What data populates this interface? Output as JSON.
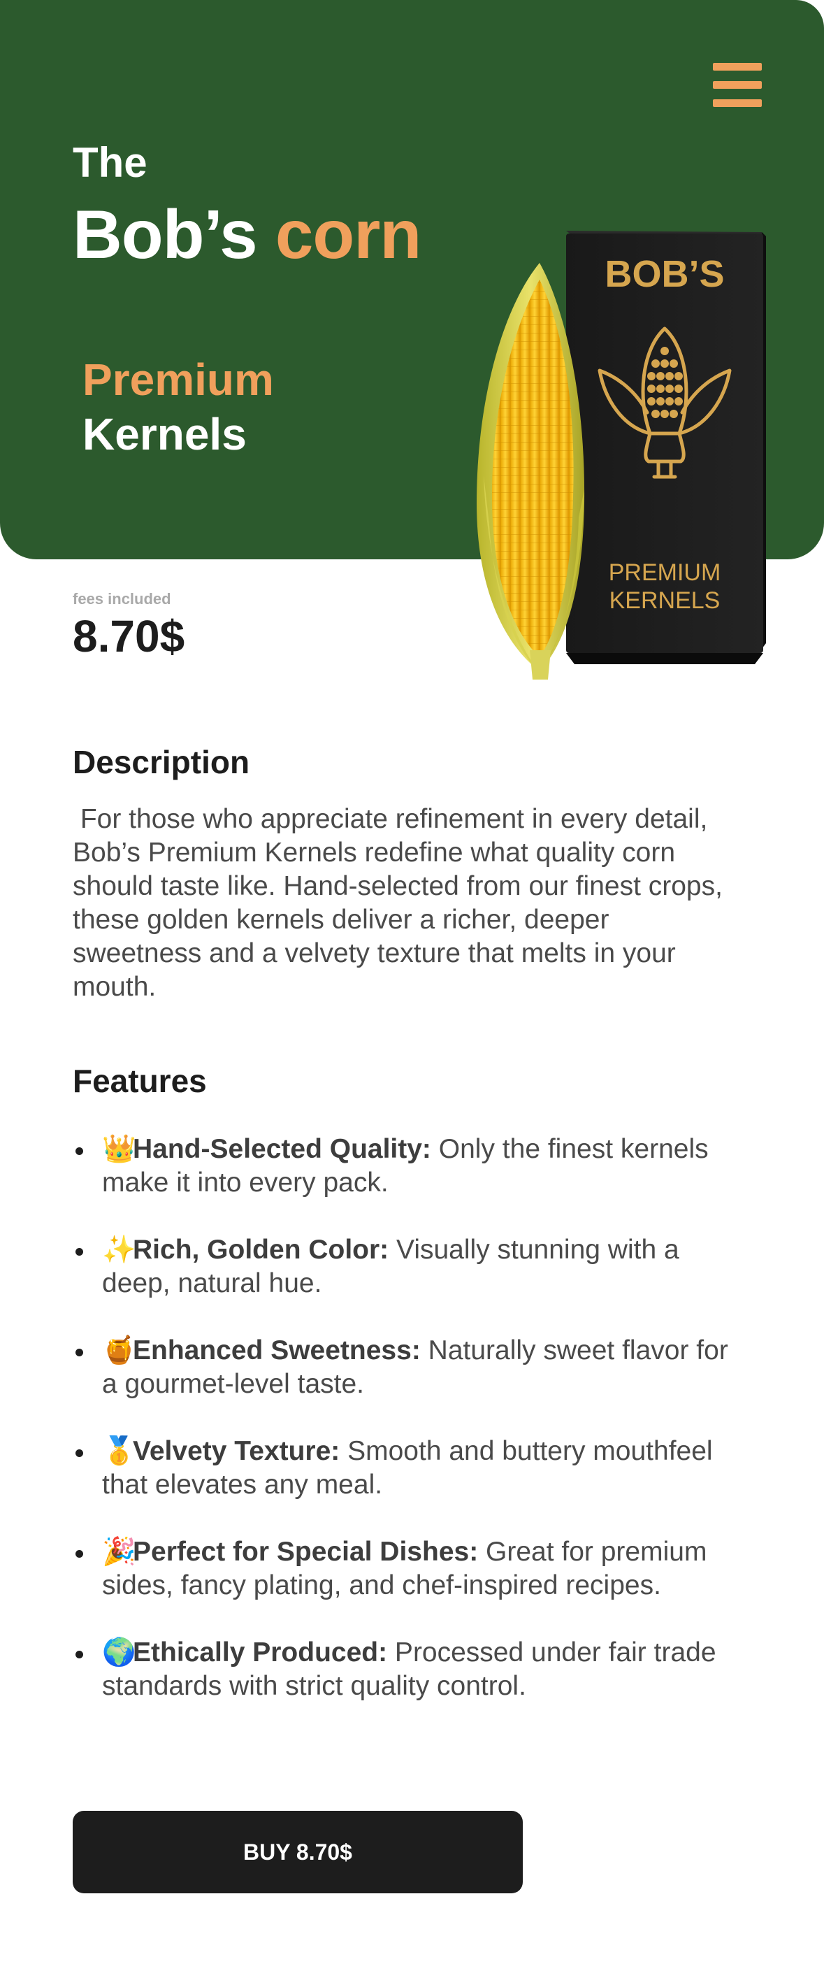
{
  "header": {
    "pre_title": "The",
    "brand_name": "Bob’s",
    "brand_accent": "corn",
    "tagline_accent": "Premium",
    "tagline": "Kernels",
    "menu_icon": "hamburger-menu-icon"
  },
  "product_box": {
    "brand": "BOB’S",
    "line1": "PREMIUM",
    "line2": "KERNELS"
  },
  "pricing": {
    "fees_note": "fees included",
    "price": "8.70$"
  },
  "description": {
    "title": "Description",
    "body": " For those who appreciate refinement in every detail, Bob’s Premium Kernels redefine what quality corn should taste like. Hand-selected from our finest crops, these golden kernels deliver a richer, deeper sweetness and a velvety texture that melts in your mouth."
  },
  "features": {
    "title": "Features",
    "items": [
      {
        "emoji": "👑",
        "label": "Hand-Selected Quality:",
        "text": " Only the finest kernels make it into every pack."
      },
      {
        "emoji": "✨",
        "label": "Rich, Golden Color:",
        "text": " Visually stunning with a deep, natural hue."
      },
      {
        "emoji": "🍯",
        "label": "Enhanced Sweetness:",
        "text": " Naturally sweet flavor for a gourmet-level taste."
      },
      {
        "emoji": "🥇",
        "label": "Velvety Texture:",
        "text": " Smooth and buttery mouthfeel that elevates any meal."
      },
      {
        "emoji": "🎉",
        "label": "Perfect for Special Dishes:",
        "text": " Great for premium sides, fancy plating, and chef-inspired recipes."
      },
      {
        "emoji": "🌍",
        "label": "Ethically Produced:",
        "text": " Processed under fair trade standards with strict quality control."
      }
    ]
  },
  "cta": {
    "buy_label": "BUY 8.70$"
  },
  "colors": {
    "hero_green": "#2c5a2d",
    "accent_orange": "#f0a05c",
    "text_dark": "#1d1d1d",
    "box_gold": "#d6a64f"
  }
}
